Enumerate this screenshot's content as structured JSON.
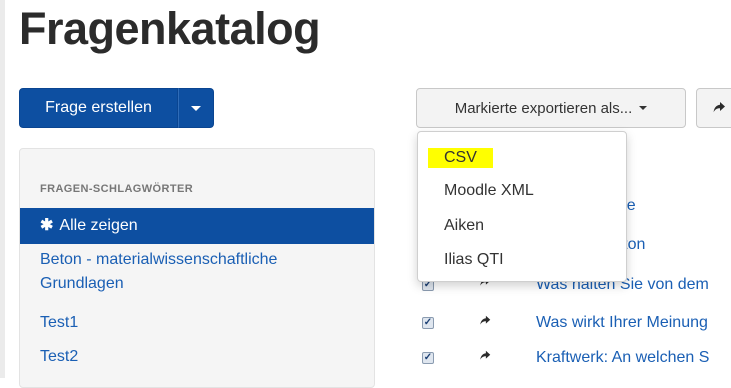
{
  "page": {
    "title": "Fragenkatalog"
  },
  "toolbar": {
    "create_label": "Frage erstellen",
    "export_label": "Markierte exportieren als..."
  },
  "sidebar": {
    "heading": "FRAGEN-SCHLAGWÖRTER",
    "items": [
      {
        "label": "Alle zeigen",
        "active": true,
        "icon": "asterisk-icon"
      },
      {
        "label": "Beton - materialwissenschaftliche Grundlagen",
        "active": false
      },
      {
        "label": "Test1",
        "active": false
      },
      {
        "label": "Test2",
        "active": false
      }
    ]
  },
  "export_menu": {
    "items": [
      {
        "label": "CSV",
        "highlighted": true
      },
      {
        "label": "Moodle XML"
      },
      {
        "label": "Aiken"
      },
      {
        "label": "Ilias QTI"
      }
    ]
  },
  "questions": [
    {
      "text": "...gen Sie Ihre",
      "checked": true
    },
    {
      "text": "...rbe hat Beton",
      "checked": true
    },
    {
      "text": "Was halten Sie von dem",
      "checked": true
    },
    {
      "text": "Was wirkt Ihrer Meinung",
      "checked": true
    },
    {
      "text": "Kraftwerk: An welchen S",
      "checked": true
    }
  ],
  "colors": {
    "primary": "#0d4fa1",
    "link": "#1a5fb4",
    "highlight": "#ffff00"
  }
}
